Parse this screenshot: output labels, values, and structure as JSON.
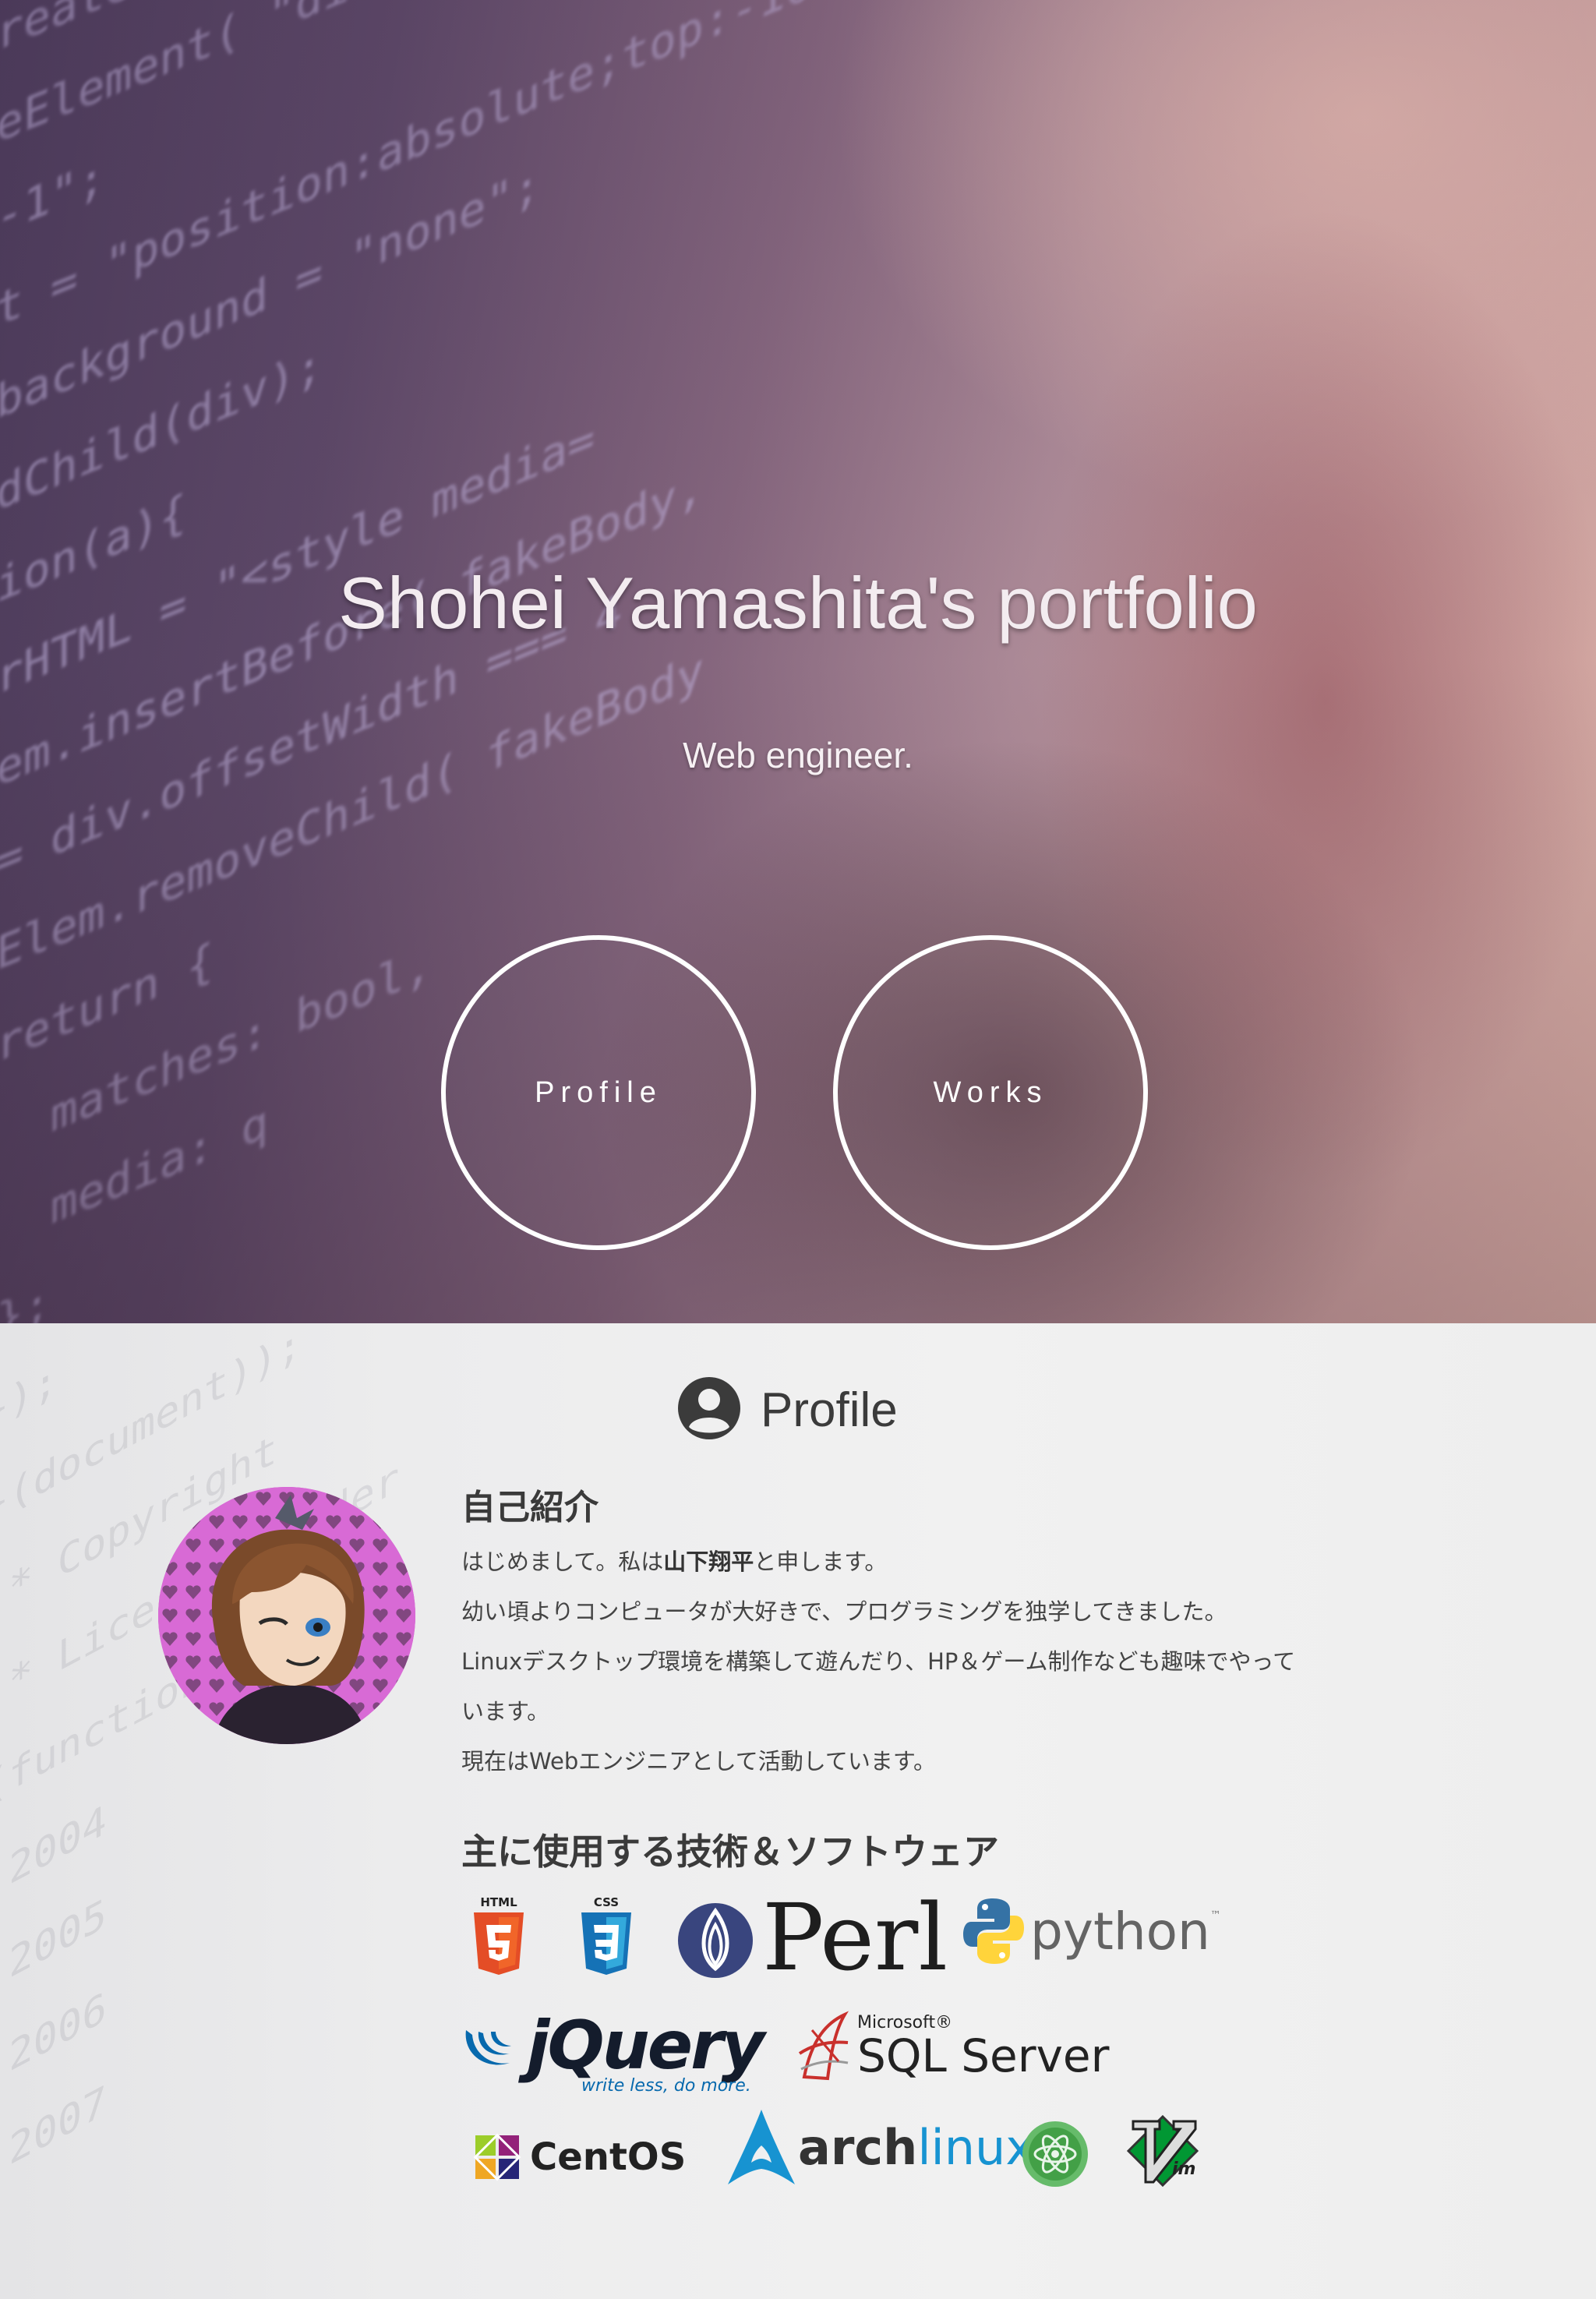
{
  "hero": {
    "title": "Shohei Yamashita's portfolio",
    "subtitle": "Web engineer.",
    "buttons": {
      "profile": "Profile",
      "works": "Works"
    }
  },
  "profile": {
    "section_title": "Profile",
    "intro_heading": "自己紹介",
    "intro_lines": {
      "line1_pre": "はじめまして。私は",
      "line1_name": "山下翔平",
      "line1_post": "と申します。",
      "line2": "幼い頃よりコンピュータが大好きで、プログラミングを独学してきました。",
      "line3": "Linuxデスクトップ環境を構築して遊んだり、HP＆ゲーム制作なども趣味でやって",
      "line4": "います。",
      "line5": "現在はWebエンジニアとして活動しています。"
    },
    "tech_heading": "主に使用する技術＆ソフトウェア",
    "tech": {
      "html5": "HTML",
      "css3": "CSS",
      "perl": "Perl",
      "python": "python",
      "python_tm": "™",
      "jquery": "jQuery",
      "jquery_tagline": "write less, do more.",
      "sqlserver_brand": "Microsoft®",
      "sqlserver": "SQL Server",
      "centos": "CentOS",
      "arch_bold": "arch",
      "arch_light": "linux"
    }
  },
  "colors": {
    "html5": "#e44d26",
    "css3": "#1572b6",
    "perl": "#39457e",
    "python_blue": "#3572a5",
    "python_yellow": "#ffd43b",
    "jquery": "#0769ad",
    "arch": "#1793d1",
    "atom": "#66bb6a",
    "vim": "#019733"
  }
}
